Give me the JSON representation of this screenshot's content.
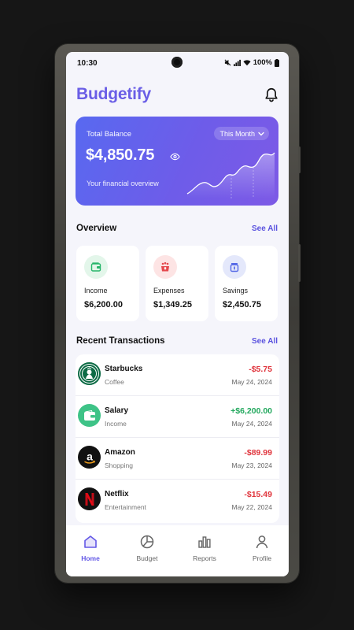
{
  "status_bar": {
    "time": "10:30",
    "battery": "100%"
  },
  "header": {
    "app_title": "Budgetify"
  },
  "balance_card": {
    "label": "Total Balance",
    "period": "This Month",
    "amount": "$4,850.75",
    "subtitle": "Your financial overview"
  },
  "overview": {
    "title": "Overview",
    "see_all": "See All",
    "cards": [
      {
        "label": "Income",
        "value": "$6,200.00",
        "icon": "wallet-icon",
        "color": "#27b56a"
      },
      {
        "label": "Expenses",
        "value": "$1,349.25",
        "icon": "expense-icon",
        "color": "#e5484d"
      },
      {
        "label": "Savings",
        "value": "$2,450.75",
        "icon": "savings-jar-icon",
        "color": "#5468e6"
      }
    ]
  },
  "transactions": {
    "title": "Recent Transactions",
    "see_all": "See All",
    "items": [
      {
        "name": "Starbucks",
        "category": "Coffee",
        "amount": "-$5.75",
        "date": "May 24, 2024",
        "type": "expense"
      },
      {
        "name": "Salary",
        "category": "Income",
        "amount": "+$6,200.00",
        "date": "May 24, 2024",
        "type": "income"
      },
      {
        "name": "Amazon",
        "category": "Shopping",
        "amount": "-$89.99",
        "date": "May 23, 2024",
        "type": "expense"
      },
      {
        "name": "Netflix",
        "category": "Entertainment",
        "amount": "-$15.49",
        "date": "May 22, 2024",
        "type": "expense"
      }
    ]
  },
  "nav": {
    "items": [
      {
        "label": "Home",
        "icon": "home-icon",
        "active": true
      },
      {
        "label": "Budget",
        "icon": "pie-chart-icon",
        "active": false
      },
      {
        "label": "Reports",
        "icon": "bar-chart-icon",
        "active": false
      },
      {
        "label": "Profile",
        "icon": "user-icon",
        "active": false
      }
    ]
  },
  "colors": {
    "accent": "#6a5ee6",
    "income": "#22a85d",
    "expense": "#e0353d"
  }
}
